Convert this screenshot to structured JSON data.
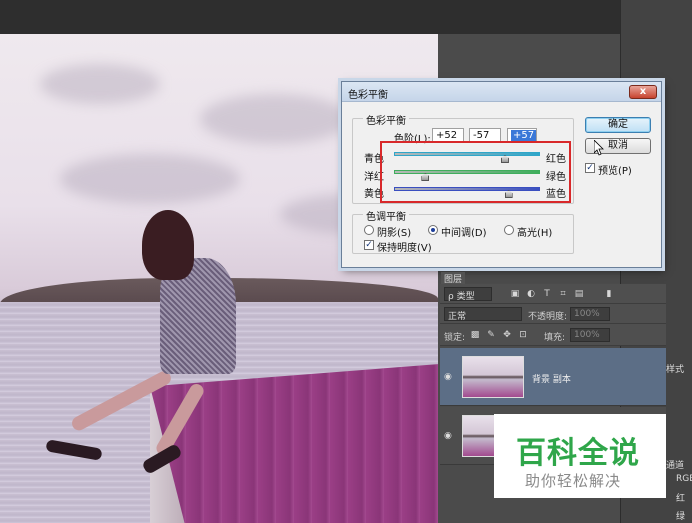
{
  "dialog": {
    "title": "色彩平衡",
    "close_glyph": "x",
    "color_balance_group": "色彩平衡",
    "levels_label": "色阶(L):",
    "levels": [
      "+52",
      "-57",
      "+57"
    ],
    "sliders": [
      {
        "left": "青色",
        "right": "红色",
        "value": 52,
        "track_color": "#2fa6c9"
      },
      {
        "left": "洋红",
        "right": "绿色",
        "value": -57,
        "track_color": "#3fae5c"
      },
      {
        "left": "黄色",
        "right": "蓝色",
        "value": 57,
        "track_color": "#3a4fc0"
      }
    ],
    "tone_group": "色调平衡",
    "tones": [
      {
        "label": "阴影(S)",
        "selected": false
      },
      {
        "label": "中间调(D)",
        "selected": true
      },
      {
        "label": "高光(H)",
        "selected": false
      }
    ],
    "preserve_luminosity": "保持明度(V)",
    "preserve_checked": true,
    "ok_label": "确定",
    "cancel_label": "取消",
    "preview_label": "预览(P)",
    "preview_checked": true,
    "check_glyph": "✓"
  },
  "layers_panel": {
    "tab_label": "图层",
    "filter_label": "ρ 类型",
    "blend_mode": "正常",
    "opacity_label": "不透明度:",
    "opacity_value": "100%",
    "lock_label": "锁定:",
    "fill_label": "填充:",
    "fill_value": "100%",
    "layers": [
      {
        "name": "背景 副本",
        "active": true
      },
      {
        "name": "",
        "active": false
      }
    ],
    "eye_glyph": "◉"
  },
  "right_side": {
    "style_label": "样式",
    "channels_label": "通道",
    "rgb_label": "RGB",
    "red_label": "红",
    "green_label": "绿"
  },
  "watermark": {
    "title": "百科全说",
    "subtitle": "助你轻松解决"
  },
  "colors": {
    "highlight_box": "#d8282a",
    "watermark_green": "#2fa64a"
  }
}
